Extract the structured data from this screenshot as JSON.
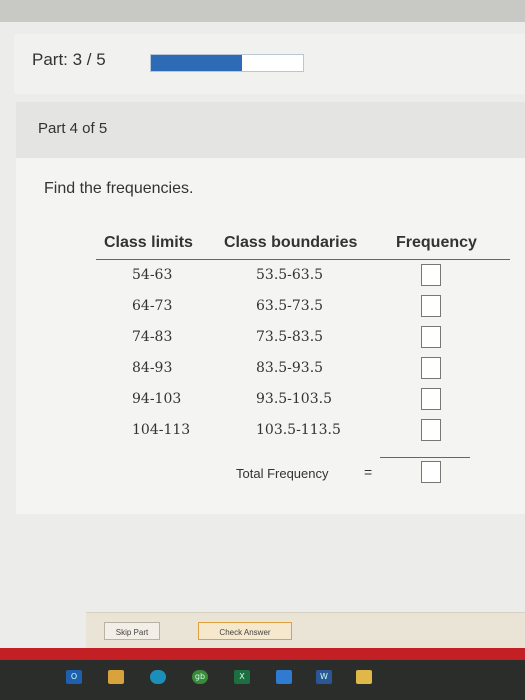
{
  "header": {
    "part_label": "Part: 3 / 5",
    "progress_fraction": 0.6,
    "progress_color": "#2d6bb7"
  },
  "card": {
    "title": "Part 4 of 5",
    "instruction": "Find the frequencies."
  },
  "table": {
    "headers": {
      "limits": "Class limits",
      "boundaries": "Class boundaries",
      "frequency": "Frequency"
    },
    "rows": [
      {
        "limits": "54-63",
        "boundaries": "53.5-63.5",
        "frequency": ""
      },
      {
        "limits": "64-73",
        "boundaries": "63.5-73.5",
        "frequency": ""
      },
      {
        "limits": "74-83",
        "boundaries": "73.5-83.5",
        "frequency": ""
      },
      {
        "limits": "84-93",
        "boundaries": "83.5-93.5",
        "frequency": ""
      },
      {
        "limits": "94-103",
        "boundaries": "93.5-103.5",
        "frequency": ""
      },
      {
        "limits": "104-113",
        "boundaries": "103.5-113.5",
        "frequency": ""
      }
    ],
    "total_label": "Total Frequency",
    "total_symbol": "=",
    "total_value": ""
  },
  "footer": {
    "skip_label": "Skip Part",
    "check_label": "Check Answer"
  },
  "taskbar": {
    "icons": [
      "outlook-icon",
      "app-icon",
      "edge-icon",
      "gb-icon",
      "excel-icon",
      "photos-icon",
      "word-icon",
      "files-icon"
    ]
  }
}
